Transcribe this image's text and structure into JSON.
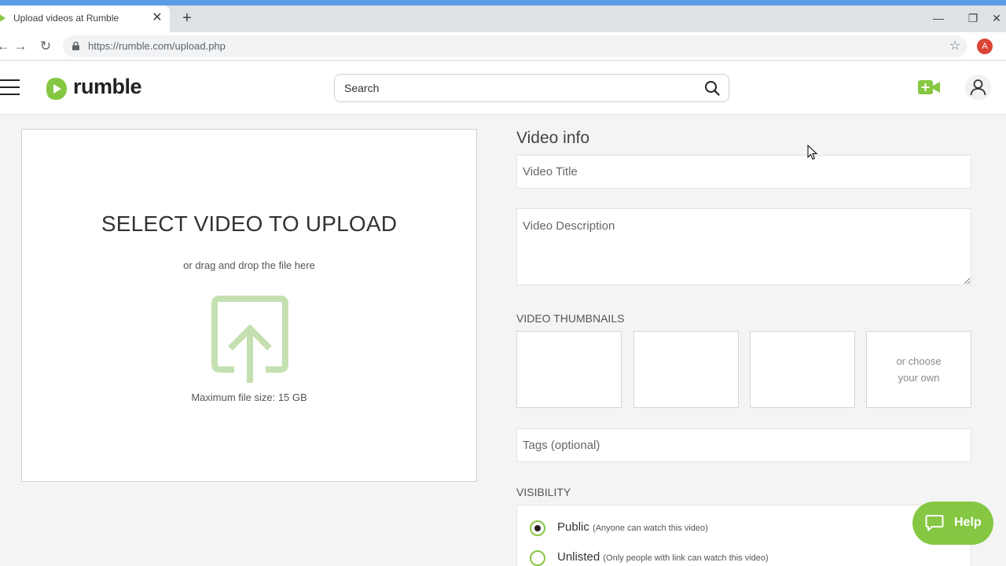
{
  "browser": {
    "tab_title": "Upload videos at Rumble",
    "tab_close": "✕",
    "new_tab": "+",
    "url": "https://rumble.com/upload.php",
    "profile_initial": "A"
  },
  "header": {
    "logo_text": "rumble",
    "search_placeholder": "Search"
  },
  "upload": {
    "title": "SELECT VIDEO TO UPLOAD",
    "subtitle": "or drag and drop the file here",
    "max_size": "Maximum file size: 15 GB"
  },
  "form": {
    "heading": "Video info",
    "title_placeholder": "Video Title",
    "description_placeholder": "Video Description",
    "thumbnails_label": "VIDEO THUMBNAILS",
    "choose_own": "or choose your own",
    "tags_placeholder": "Tags (optional)",
    "visibility_label": "VISIBILITY",
    "visibility_options": [
      {
        "label": "Public",
        "hint": "(Anyone can watch this video)",
        "checked": true
      },
      {
        "label": "Unlisted",
        "hint": "(Only people with link can watch this video)",
        "checked": false
      }
    ]
  },
  "help": {
    "label": "Help"
  },
  "colors": {
    "brand_green": "#85c742",
    "upload_icon_green": "#c5e0b0",
    "browser_accent": "#5b9ce6"
  }
}
